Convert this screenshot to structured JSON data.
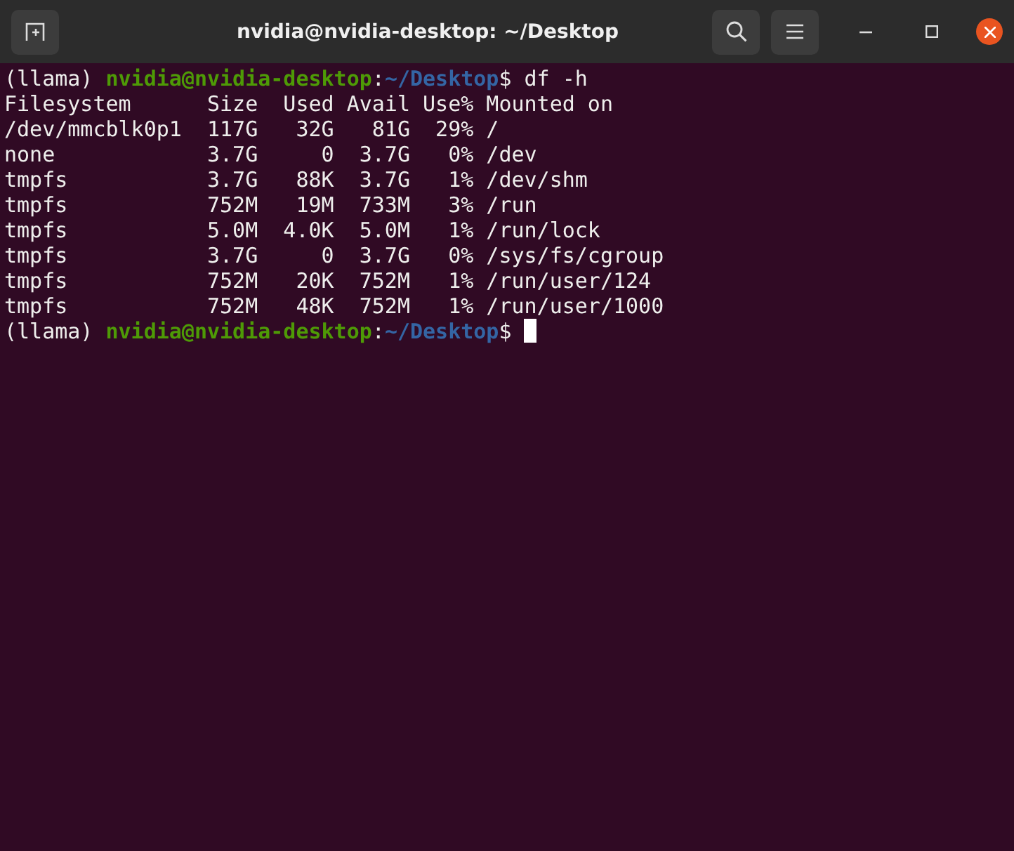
{
  "window": {
    "title": "nvidia@nvidia-desktop: ~/Desktop"
  },
  "terminal": {
    "lines": [
      {
        "kind": "prompt",
        "env": "(llama)",
        "user_host": "nvidia@nvidia-desktop",
        "separator": ":",
        "path": "~/Desktop",
        "symbol": "$",
        "command": "df -h",
        "cursor": false
      },
      {
        "kind": "output",
        "text": "Filesystem      Size  Used Avail Use% Mounted on"
      },
      {
        "kind": "output",
        "text": "/dev/mmcblk0p1  117G   32G   81G  29% /"
      },
      {
        "kind": "output",
        "text": "none            3.7G     0  3.7G   0% /dev"
      },
      {
        "kind": "output",
        "text": "tmpfs           3.7G   88K  3.7G   1% /dev/shm"
      },
      {
        "kind": "output",
        "text": "tmpfs           752M   19M  733M   3% /run"
      },
      {
        "kind": "output",
        "text": "tmpfs           5.0M  4.0K  5.0M   1% /run/lock"
      },
      {
        "kind": "output",
        "text": "tmpfs           3.7G     0  3.7G   0% /sys/fs/cgroup"
      },
      {
        "kind": "output",
        "text": "tmpfs           752M   20K  752M   1% /run/user/124"
      },
      {
        "kind": "output",
        "text": "tmpfs           752M   48K  752M   1% /run/user/1000"
      },
      {
        "kind": "prompt",
        "env": "(llama)",
        "user_host": "nvidia@nvidia-desktop",
        "separator": ":",
        "path": "~/Desktop",
        "symbol": "$",
        "cursor": true
      }
    ]
  }
}
